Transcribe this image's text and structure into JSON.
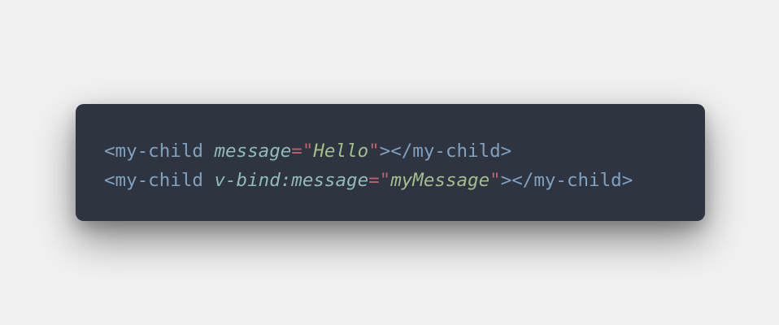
{
  "code": {
    "lines": [
      {
        "open_tag": "<my-child",
        "attr": "message",
        "eq": "=",
        "quote_open": "\"",
        "value": "Hello",
        "quote_close": "\"",
        "close_tags": "></my-child>"
      },
      {
        "open_tag": "<my-child",
        "attr": "v-bind:message",
        "eq": "=",
        "quote_open": "\"",
        "value": "myMessage",
        "quote_close": "\"",
        "close_tags": "></my-child>"
      }
    ]
  },
  "colors": {
    "background": "#f1f1f1",
    "code_background": "#2e3440",
    "tag": "#81a1c1",
    "attribute": "#8fbcbb",
    "punctuation": "#bf616a",
    "string": "#a3be8c"
  }
}
